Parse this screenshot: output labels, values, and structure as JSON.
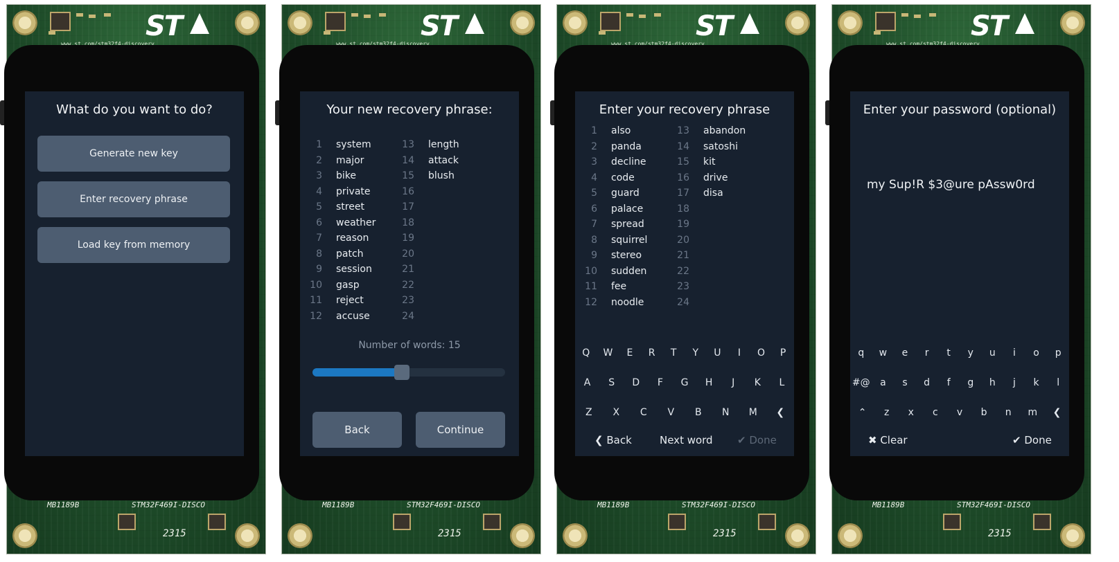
{
  "board": {
    "brand": "ST",
    "url": "www.st.com/stm32f4-discovery",
    "model_top": "MB1189B",
    "model_name": "STM32F469I-DISCO",
    "code": "2315"
  },
  "screens": {
    "menu": {
      "title": "What do you want to do?",
      "buttons": [
        "Generate new key",
        "Enter recovery phrase",
        "Load key from memory"
      ]
    },
    "new_phrase": {
      "title": "Your new recovery phrase:",
      "words": [
        "system",
        "major",
        "bike",
        "private",
        "street",
        "weather",
        "reason",
        "patch",
        "session",
        "gasp",
        "reject",
        "accuse",
        "length",
        "attack",
        "blush",
        "",
        "",
        "",
        "",
        "",
        "",
        "",
        "",
        ""
      ],
      "count_label": "Number of words: 15",
      "slider": {
        "min": 12,
        "max": 24,
        "value": 15
      },
      "back_label": "Back",
      "continue_label": "Continue"
    },
    "enter_phrase": {
      "title": "Enter your recovery phrase",
      "words": [
        "also",
        "panda",
        "decline",
        "code",
        "guard",
        "palace",
        "spread",
        "squirrel",
        "stereo",
        "sudden",
        "fee",
        "noodle",
        "abandon",
        "satoshi",
        "kit",
        "drive",
        "disa",
        "",
        "",
        "",
        "",
        "",
        "",
        ""
      ],
      "keyboard": [
        [
          "Q",
          "W",
          "E",
          "R",
          "T",
          "Y",
          "U",
          "I",
          "O",
          "P"
        ],
        [
          "A",
          "S",
          "D",
          "F",
          "G",
          "H",
          "J",
          "K",
          "L"
        ],
        [
          "Z",
          "X",
          "C",
          "V",
          "B",
          "N",
          "M",
          "❮"
        ]
      ],
      "back_label": "❮ Back",
      "next_label": "Next word",
      "done_label": "✔ Done"
    },
    "password": {
      "title": "Enter your password (optional)",
      "value": "my Sup!R $3@ure pAssw0rd",
      "keyboard": [
        [
          "q",
          "w",
          "e",
          "r",
          "t",
          "y",
          "u",
          "i",
          "o",
          "p"
        ],
        [
          "#@",
          "a",
          "s",
          "d",
          "f",
          "g",
          "h",
          "j",
          "k",
          "l"
        ],
        [
          "⌃",
          "z",
          "x",
          "c",
          "v",
          "b",
          "n",
          "m",
          "❮"
        ]
      ],
      "clear_label": "✖ Clear",
      "done_label": "✔ Done"
    }
  },
  "colors": {
    "screen_bg": "#17212f",
    "button_bg": "#4d5d71",
    "accent": "#1c78c2",
    "muted": "#6b7788"
  }
}
